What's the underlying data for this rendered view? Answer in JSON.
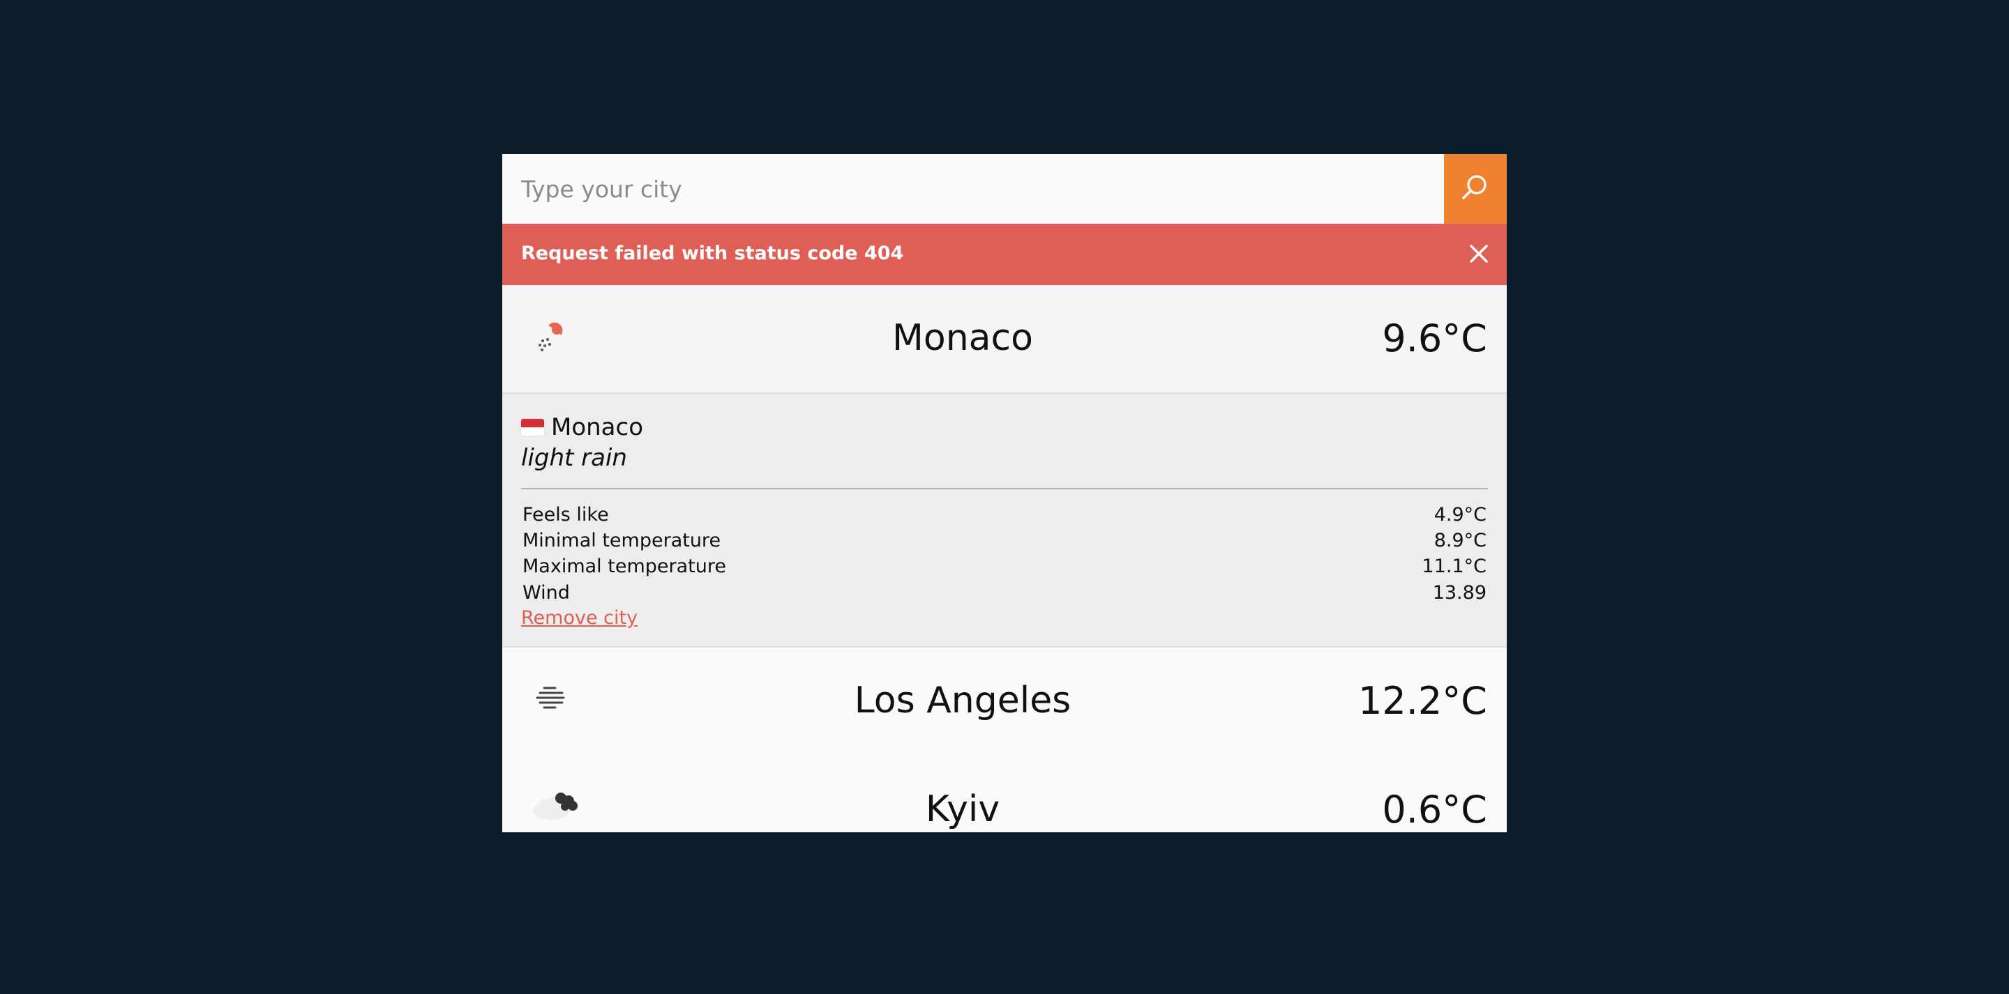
{
  "search": {
    "placeholder": "Type your city",
    "value": "",
    "button_icon": "search-icon"
  },
  "error": {
    "message": "Request failed with status code 404",
    "close_icon": "close-icon"
  },
  "colors": {
    "background": "#0b1d2b",
    "accent": "#f0812f",
    "error": "#df5f57",
    "panel": "#fafafa"
  },
  "cities": [
    {
      "name": "Monaco",
      "temperature": "9.6°C",
      "icon": "light-rain-icon",
      "expanded": true
    },
    {
      "name": "Los Angeles",
      "temperature": "12.2°C",
      "icon": "mist-icon",
      "expanded": false
    },
    {
      "name": "Kyiv",
      "temperature": "0.6°C",
      "icon": "broken-clouds-icon",
      "expanded": false
    }
  ],
  "details": {
    "flag_icon": "monaco-flag-icon",
    "city": "Monaco",
    "description": "light rain",
    "stats": [
      {
        "label": "Feels like",
        "value": "4.9°C"
      },
      {
        "label": "Minimal temperature",
        "value": "8.9°C"
      },
      {
        "label": "Maximal temperature",
        "value": "11.1°C"
      },
      {
        "label": "Wind",
        "value": "13.89"
      }
    ],
    "remove_label": "Remove city"
  }
}
